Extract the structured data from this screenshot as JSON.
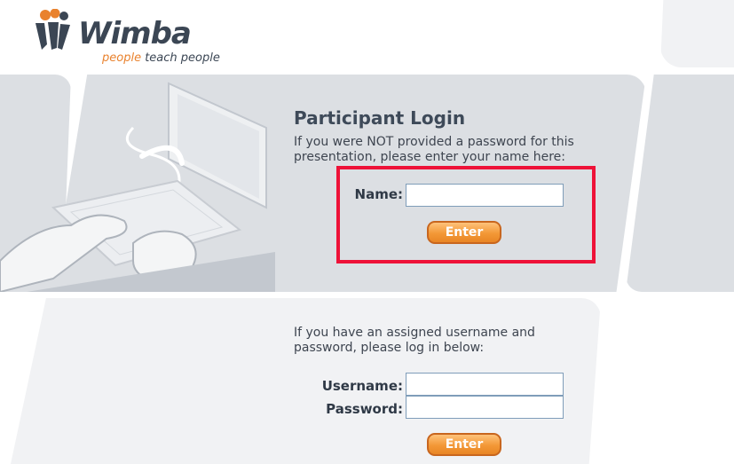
{
  "logo": {
    "name": "Wimba",
    "tagline_highlight": "people",
    "tagline_rest": " teach people",
    "colors": {
      "wordmark": "#3b4654",
      "accent": "#e9822e",
      "figure": "#3b4654"
    }
  },
  "participant_login": {
    "title": "Participant Login",
    "description_line1": "If you were NOT provided a password for this",
    "description_line2": "presentation, please enter your name here:",
    "name_label": "Name:",
    "name_value": "",
    "enter_label": "Enter"
  },
  "member_login": {
    "description_line1": "If you have an assigned username and",
    "description_line2": "password, please log in below:",
    "username_label": "Username:",
    "username_value": "",
    "password_label": "Password:",
    "password_value": "",
    "enter_label": "Enter"
  },
  "colors": {
    "panel": "#dcdfe3",
    "panel_light": "#f1f2f4",
    "button": "#f39837",
    "highlight_box": "#ee1238",
    "text": "#3e4550"
  }
}
